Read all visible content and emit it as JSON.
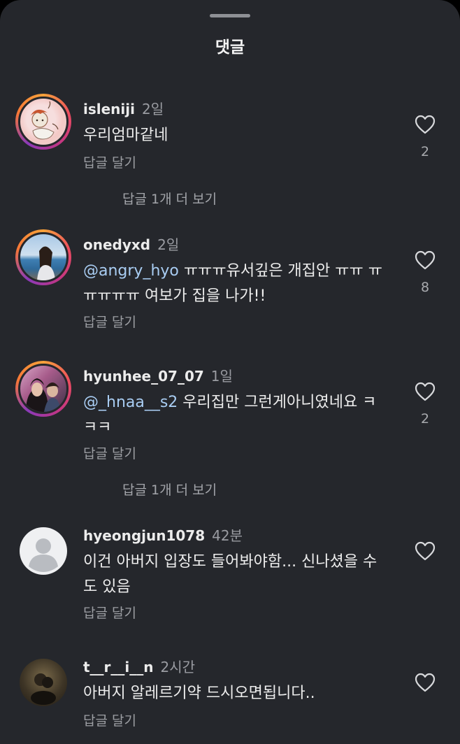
{
  "sheet": {
    "title": "댓글"
  },
  "comments": [
    {
      "user": "isleniji",
      "time": "2일",
      "text": "우리엄마같네",
      "reply": "답글 달기",
      "likes": "2"
    },
    {
      "user": "onedyxd",
      "time": "2일",
      "mention": "@angry_hyo",
      "text": " ㅠㅠㅠ유서깊은 개집안 ㅠㅠ ㅠㅠㅠㅠㅠ 여보가 집을 나가!!",
      "reply": "답글 달기",
      "likes": "8"
    },
    {
      "user": "hyunhee_07_07",
      "time": "1일",
      "mention": "@_hnaa__s2",
      "text": " 우리집만 그런게아니였네요 ㅋㅋㅋ",
      "reply": "답글 달기",
      "likes": "2"
    },
    {
      "user": "hyeongjun1078",
      "time": "42분",
      "text": "이건 아버지 입장도 들어봐야함... 신나셨을 수도 있음",
      "reply": "답글 달기",
      "likes": ""
    },
    {
      "user": "t__r__i__n",
      "time": "2시간",
      "text": "아버지 알레르기약 드시오면됩니다..",
      "reply": "답글 달기",
      "likes": ""
    }
  ],
  "more_replies": [
    "답글 1개 더 보기",
    "답글 1개 더 보기"
  ]
}
